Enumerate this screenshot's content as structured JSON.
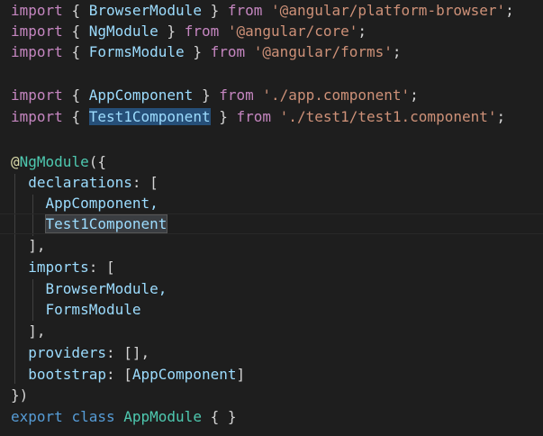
{
  "editor": {
    "language": "typescript",
    "theme": {
      "background": "#1e1e1e",
      "keyword": "#c586c0",
      "identifier": "#9cdcfe",
      "string": "#ce9178",
      "class": "#4ec9b0",
      "selection": "#264f78"
    },
    "lines": [
      {
        "kw": "import",
        "o": "{",
        "id": "BrowserModule",
        "c": "}",
        "from": "from",
        "str": "'@angular/platform-browser'",
        "end": ";"
      },
      {
        "kw": "import",
        "o": "{",
        "id": "NgModule",
        "c": "}",
        "from": "from",
        "str": "'@angular/core'",
        "end": ";"
      },
      {
        "kw": "import",
        "o": "{",
        "id": "FormsModule",
        "c": "}",
        "from": "from",
        "str": "'@angular/forms'",
        "end": ";"
      },
      {
        "kw": "import",
        "o": "{",
        "id": "AppComponent",
        "c": "}",
        "from": "from",
        "str": "'./app.component'",
        "end": ";"
      },
      {
        "kw": "import",
        "o": "{",
        "id": "Test1Component",
        "c": "}",
        "from": "from",
        "str": "'./test1/test1.component'",
        "end": ";"
      }
    ],
    "decorator": {
      "at": "@",
      "name": "NgModule",
      "open": "({",
      "declarations_key": "declarations",
      "declarations_open": ": [",
      "declarations": [
        "AppComponent,",
        "Test1Component"
      ],
      "declarations_close": "],",
      "imports_key": "imports",
      "imports_open": ": [",
      "imports": [
        "BrowserModule,",
        "FormsModule"
      ],
      "imports_close": "],",
      "providers_key": "providers",
      "providers_rest": ": [],",
      "bootstrap_key": "bootstrap",
      "bootstrap_open": ": [",
      "bootstrap_value": "AppComponent",
      "bootstrap_close": "]",
      "close": "})"
    },
    "export_line": {
      "export": "export",
      "class": "class",
      "name": "AppModule",
      "body": "{ }"
    }
  }
}
